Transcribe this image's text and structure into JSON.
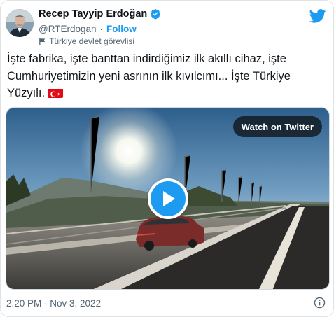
{
  "author": {
    "name": "Recep Tayyip Erdoğan",
    "handle": "@RTErdogan",
    "separator": "·",
    "follow_label": "Follow",
    "account_label": "Türkiye devlet görevlisi"
  },
  "tweet": {
    "text": "İşte fabrika, işte banttan indirdiğimiz ilk akıllı cihaz, işte Cumhuriyetimizin yeni asrının ilk kıvılcımı... İşte Türkiye Yüzyılı.",
    "emoji": "turkey-flag"
  },
  "media": {
    "watch_label": "Watch on Twitter",
    "play_icon": "play-icon"
  },
  "footer": {
    "timestamp": "2:20 PM · Nov 3, 2022"
  },
  "icons": {
    "verified": "verified-badge-icon",
    "twitter": "twitter-bird-icon",
    "label": "flag-icon",
    "info": "info-icon"
  },
  "colors": {
    "accent": "#1d9bf0",
    "text_primary": "#0f1419",
    "text_secondary": "#536471",
    "flag_red": "#e30a17"
  }
}
